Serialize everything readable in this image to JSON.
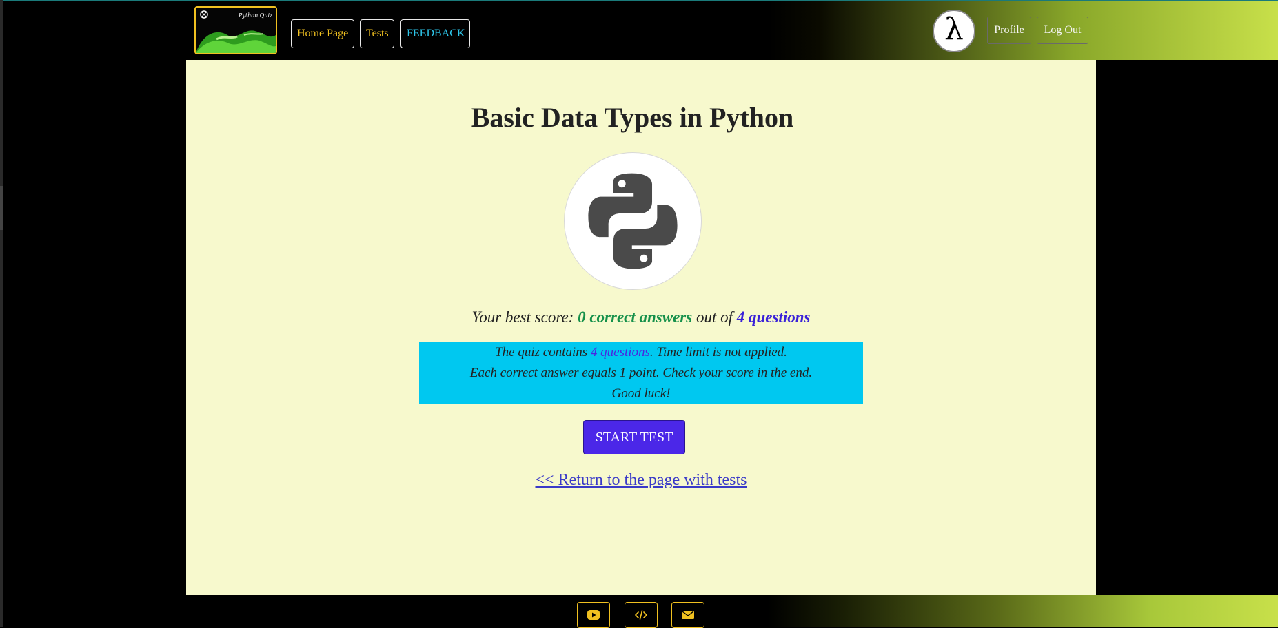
{
  "header": {
    "logo_text": "Python Quiz",
    "nav": {
      "home": "Home Page",
      "tests": "Tests",
      "feedback": "FEEDBACK"
    },
    "avatar_symbol": "λ",
    "profile": "Profile",
    "logout": "Log Out"
  },
  "main": {
    "title": "Basic Data Types in Python",
    "score": {
      "prefix": "Your best score: ",
      "correct": "0 correct answers",
      "middle": " out of ",
      "total": "4 questions"
    },
    "info": {
      "line1_prefix": "The quiz contains ",
      "line1_count": "4 questions",
      "line1_suffix": ". Time limit is not applied.",
      "line2": "Each correct answer equals 1 point. Check your score in the end.",
      "line3": "Good luck!"
    },
    "start_button": "START TEST",
    "return_link": "<< Return to the page with tests"
  },
  "footer": {
    "icons": [
      "youtube-icon",
      "code-icon",
      "envelope-icon"
    ]
  },
  "colors": {
    "accent_yellow": "#f0c020",
    "accent_cyan": "#2dc4e8",
    "main_bg": "#f7f9cd",
    "info_bg": "#00c8f0",
    "start_button_bg": "#4b27e8",
    "score_green": "#15904a",
    "score_blue": "#3a22d8"
  }
}
